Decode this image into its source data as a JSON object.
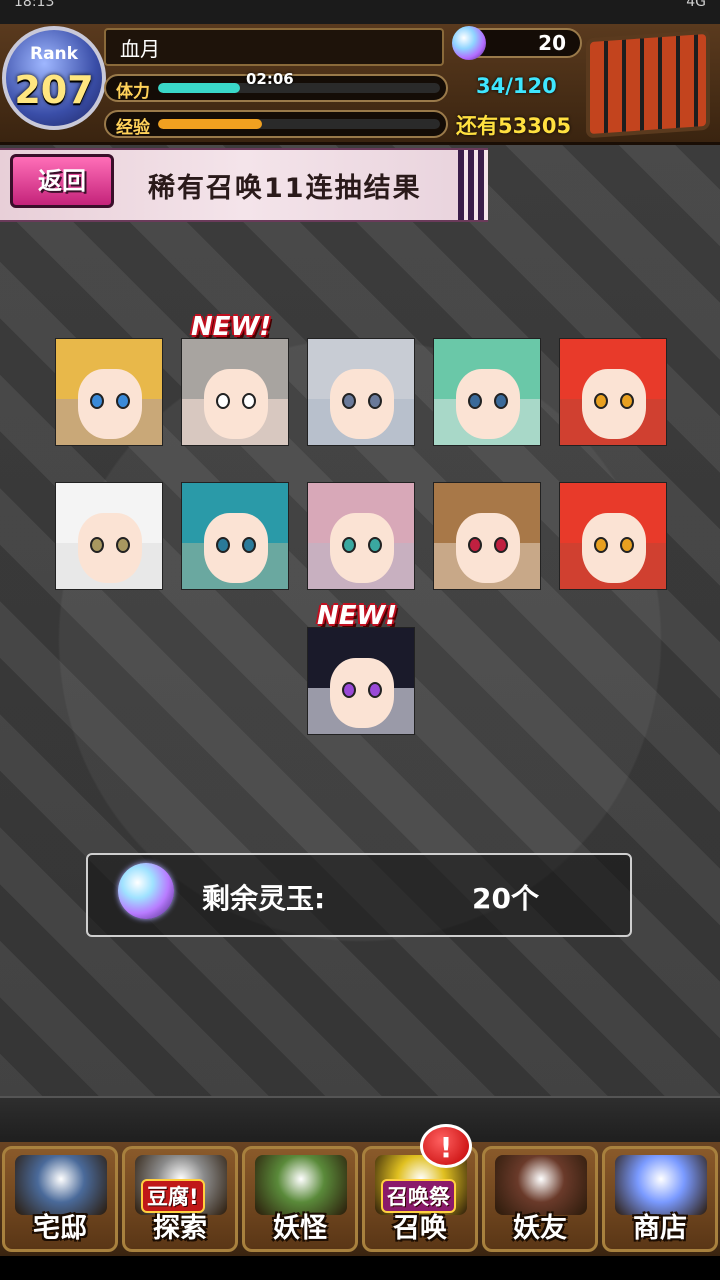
{
  "status": {
    "time": "18:13",
    "system": "4G"
  },
  "player": {
    "rank_label": "Rank",
    "rank": "207",
    "name": "血月",
    "stamina_label": "体力",
    "stamina_timer": "02:06",
    "stamina_fill": 0.29,
    "exp_label": "经验",
    "exp_fill": 0.37,
    "gems": "20",
    "stamina_text": "34/120",
    "remain_text": "还有53305"
  },
  "banner": {
    "back": "返回",
    "title": "稀有召唤11连抽结果"
  },
  "results": {
    "new_label": "NEW!",
    "cards": [
      {
        "name": "card-1",
        "hair": "#e8b84a",
        "bg": "#c9a878",
        "eye": "#3a8ad8",
        "new": false
      },
      {
        "name": "card-2",
        "hair": "#a8a4a0",
        "bg": "#d8c8c0",
        "eye": "#ffffff",
        "new": true
      },
      {
        "name": "card-3",
        "hair": "#c8ccd4",
        "bg": "#b8c0cc",
        "eye": "#6a7a9a",
        "new": false
      },
      {
        "name": "card-4",
        "hair": "#6ac8a8",
        "bg": "#a8d8c8",
        "eye": "#3a6a9a",
        "new": false
      },
      {
        "name": "card-5",
        "hair": "#e83a2a",
        "bg": "#d04030",
        "eye": "#e8a020",
        "new": false
      },
      {
        "name": "card-6",
        "hair": "#f4f4f4",
        "bg": "#e8e8e8",
        "eye": "#a89860",
        "new": false
      },
      {
        "name": "card-7",
        "hair": "#2a9aa8",
        "bg": "#6aa8a0",
        "eye": "#2a7a9a",
        "new": false
      },
      {
        "name": "card-8",
        "hair": "#d8a8b8",
        "bg": "#c8b0c0",
        "eye": "#3aa8a0",
        "new": false
      },
      {
        "name": "card-9",
        "hair": "#a87848",
        "bg": "#c8a888",
        "eye": "#c02040",
        "new": false
      },
      {
        "name": "card-10",
        "hair": "#e83a2a",
        "bg": "#d04030",
        "eye": "#e8a020",
        "new": false
      },
      {
        "name": "card-11",
        "hair": "#1a1a2a",
        "bg": "#9a9aa8",
        "eye": "#9a4ad8",
        "new": true
      }
    ]
  },
  "remaining": {
    "label": "剩余灵玉:",
    "value": "20个"
  },
  "nav": {
    "items": [
      {
        "name": "home",
        "label": "宅邸"
      },
      {
        "name": "explore",
        "label": "探索",
        "tag": "豆腐!"
      },
      {
        "name": "yokai",
        "label": "妖怪"
      },
      {
        "name": "summon",
        "label": "召唤",
        "tag": "召唤祭"
      },
      {
        "name": "friends",
        "label": "妖友"
      },
      {
        "name": "shop",
        "label": "商店"
      }
    ],
    "alert": "!"
  }
}
